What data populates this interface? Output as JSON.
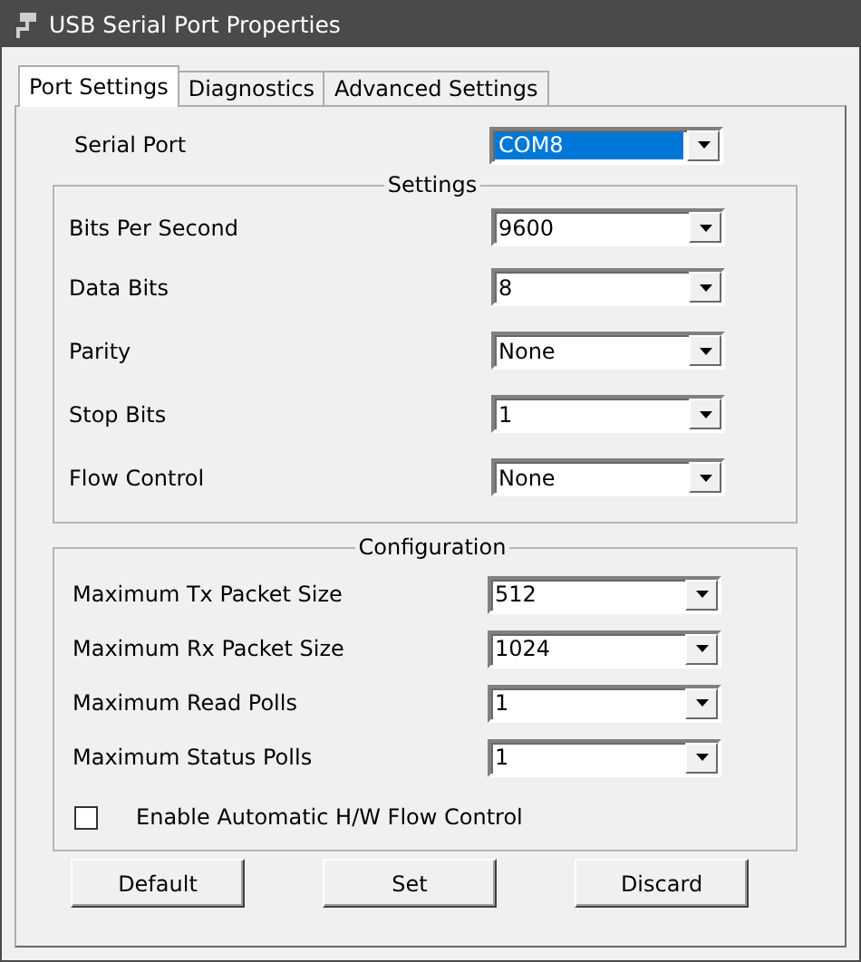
{
  "window": {
    "title": "USB Serial Port Properties"
  },
  "tabs": [
    {
      "label": "Port Settings",
      "selected": true
    },
    {
      "label": "Diagnostics",
      "selected": false
    },
    {
      "label": "Advanced Settings",
      "selected": false
    }
  ],
  "serial_port": {
    "label": "Serial Port",
    "value": "COM8",
    "highlighted": true
  },
  "settings": {
    "title": "Settings",
    "rows": [
      {
        "label": "Bits Per Second",
        "value": "9600",
        "highlighted": false
      },
      {
        "label": "Data Bits",
        "value": "8",
        "highlighted": false
      },
      {
        "label": "Parity",
        "value": "None",
        "highlighted": false
      },
      {
        "label": "Stop Bits",
        "value": "1",
        "highlighted": false
      },
      {
        "label": "Flow Control",
        "value": "None",
        "highlighted": false
      }
    ]
  },
  "configuration": {
    "title": "Configuration",
    "rows": [
      {
        "label": "Maximum Tx Packet Size",
        "value": "512",
        "highlighted": false
      },
      {
        "label": "Maximum Rx Packet Size",
        "value": "1024",
        "highlighted": false
      },
      {
        "label": "Maximum Read Polls",
        "value": "1",
        "highlighted": false
      },
      {
        "label": "Maximum Status Polls",
        "value": "1",
        "highlighted": false
      }
    ],
    "checkbox": {
      "label": "Enable Automatic H/W Flow Control",
      "checked": false
    }
  },
  "buttons": [
    "Default",
    "Set",
    "Discard"
  ]
}
